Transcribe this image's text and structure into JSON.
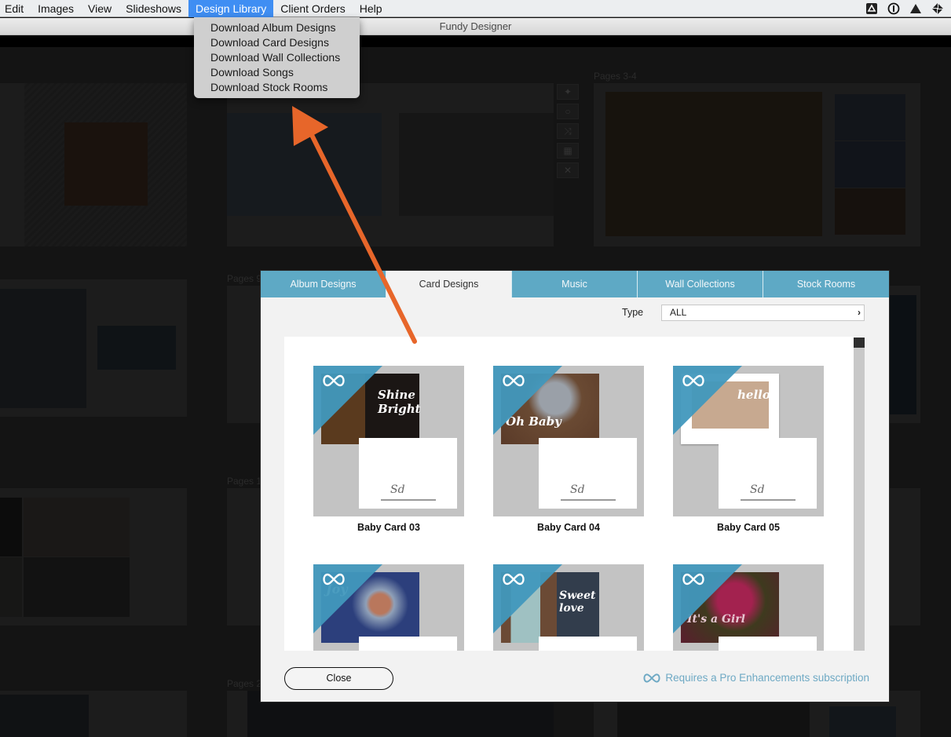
{
  "menubar": {
    "items": [
      "Edit",
      "Images",
      "View",
      "Slideshows",
      "Design Library",
      "Client Orders",
      "Help"
    ],
    "active_index": 4,
    "status_icons": [
      "google-drive-icon",
      "onepassword-icon",
      "warning-triangle-icon",
      "pinwheel-icon"
    ]
  },
  "window": {
    "title": "Fundy Designer"
  },
  "dropdown": {
    "items": [
      "Download Album Designs",
      "Download Card Designs",
      "Download Wall Collections",
      "Download Songs",
      "Download Stock Rooms"
    ]
  },
  "background": {
    "page_labels": [
      "Pages 3-4",
      "Pages 9",
      "Pages 1",
      "Pages 2"
    ],
    "tools": [
      "crosshair-icon",
      "rotate-icon",
      "shuffle-icon",
      "grid-icon",
      "close-icon"
    ]
  },
  "dialog": {
    "tabs": [
      "Album Designs",
      "Card Designs",
      "Music",
      "Wall Collections",
      "Stock Rooms"
    ],
    "selected_tab": 1,
    "type_label": "Type",
    "type_value": "ALL",
    "cards": [
      {
        "name": "Baby Card 03",
        "script": "Shine Bright",
        "front_color": "#1b1614",
        "accent": "#b9822b",
        "pro": true
      },
      {
        "name": "Baby Card 04",
        "script": "Oh Baby",
        "front_color": "#6a4a33",
        "accent": "#8fa0c8",
        "pro": true
      },
      {
        "name": "Baby Card 05",
        "script": "hello",
        "front_color": "#ffffff",
        "accent": "#c7a990",
        "pro": true
      },
      {
        "name": "",
        "script": "Joy",
        "front_color": "#2c3f7c",
        "accent": "#b9775c",
        "pro": true
      },
      {
        "name": "",
        "script": "Sweet love",
        "front_color": "#323d4c",
        "accent": "#9fc1c2",
        "pro": true
      },
      {
        "name": "",
        "script": "It's a Girl",
        "front_color": "#5a1e2e",
        "accent": "#a3224f",
        "pro": true
      }
    ],
    "close_label": "Close",
    "pro_note": "Requires a Pro Enhancements subscription"
  },
  "colors": {
    "tab_blue": "#5ea9c5",
    "corner_blue": "#4198bd",
    "menu_highlight": "#3f8ef3",
    "arrow_orange": "#e7662a",
    "pro_note": "#6ea9c4"
  }
}
